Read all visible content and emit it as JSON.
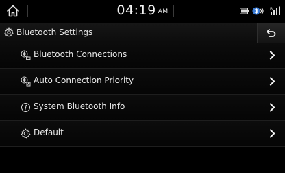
{
  "status_bar": {
    "time": "04:19",
    "ampm": "AM",
    "icons": [
      "home-icon",
      "battery-icon",
      "bluetooth-device-icon",
      "signal-icon"
    ]
  },
  "header": {
    "icon": "gear-icon",
    "title": "Bluetooth Settings",
    "back_icon": "back-arrow-icon"
  },
  "menu": {
    "items": [
      {
        "label": "Bluetooth Connections",
        "icon": "bluetooth-connections-icon"
      },
      {
        "label": "Auto Connection Priority",
        "icon": "auto-connection-icon"
      },
      {
        "label": "System Bluetooth Info",
        "icon": "info-icon"
      },
      {
        "label": "Default",
        "icon": "gear-icon"
      }
    ]
  },
  "colors": {
    "background": "#000000",
    "text": "#e8e8e8",
    "accent_bluetooth": "#3a7bd5"
  }
}
